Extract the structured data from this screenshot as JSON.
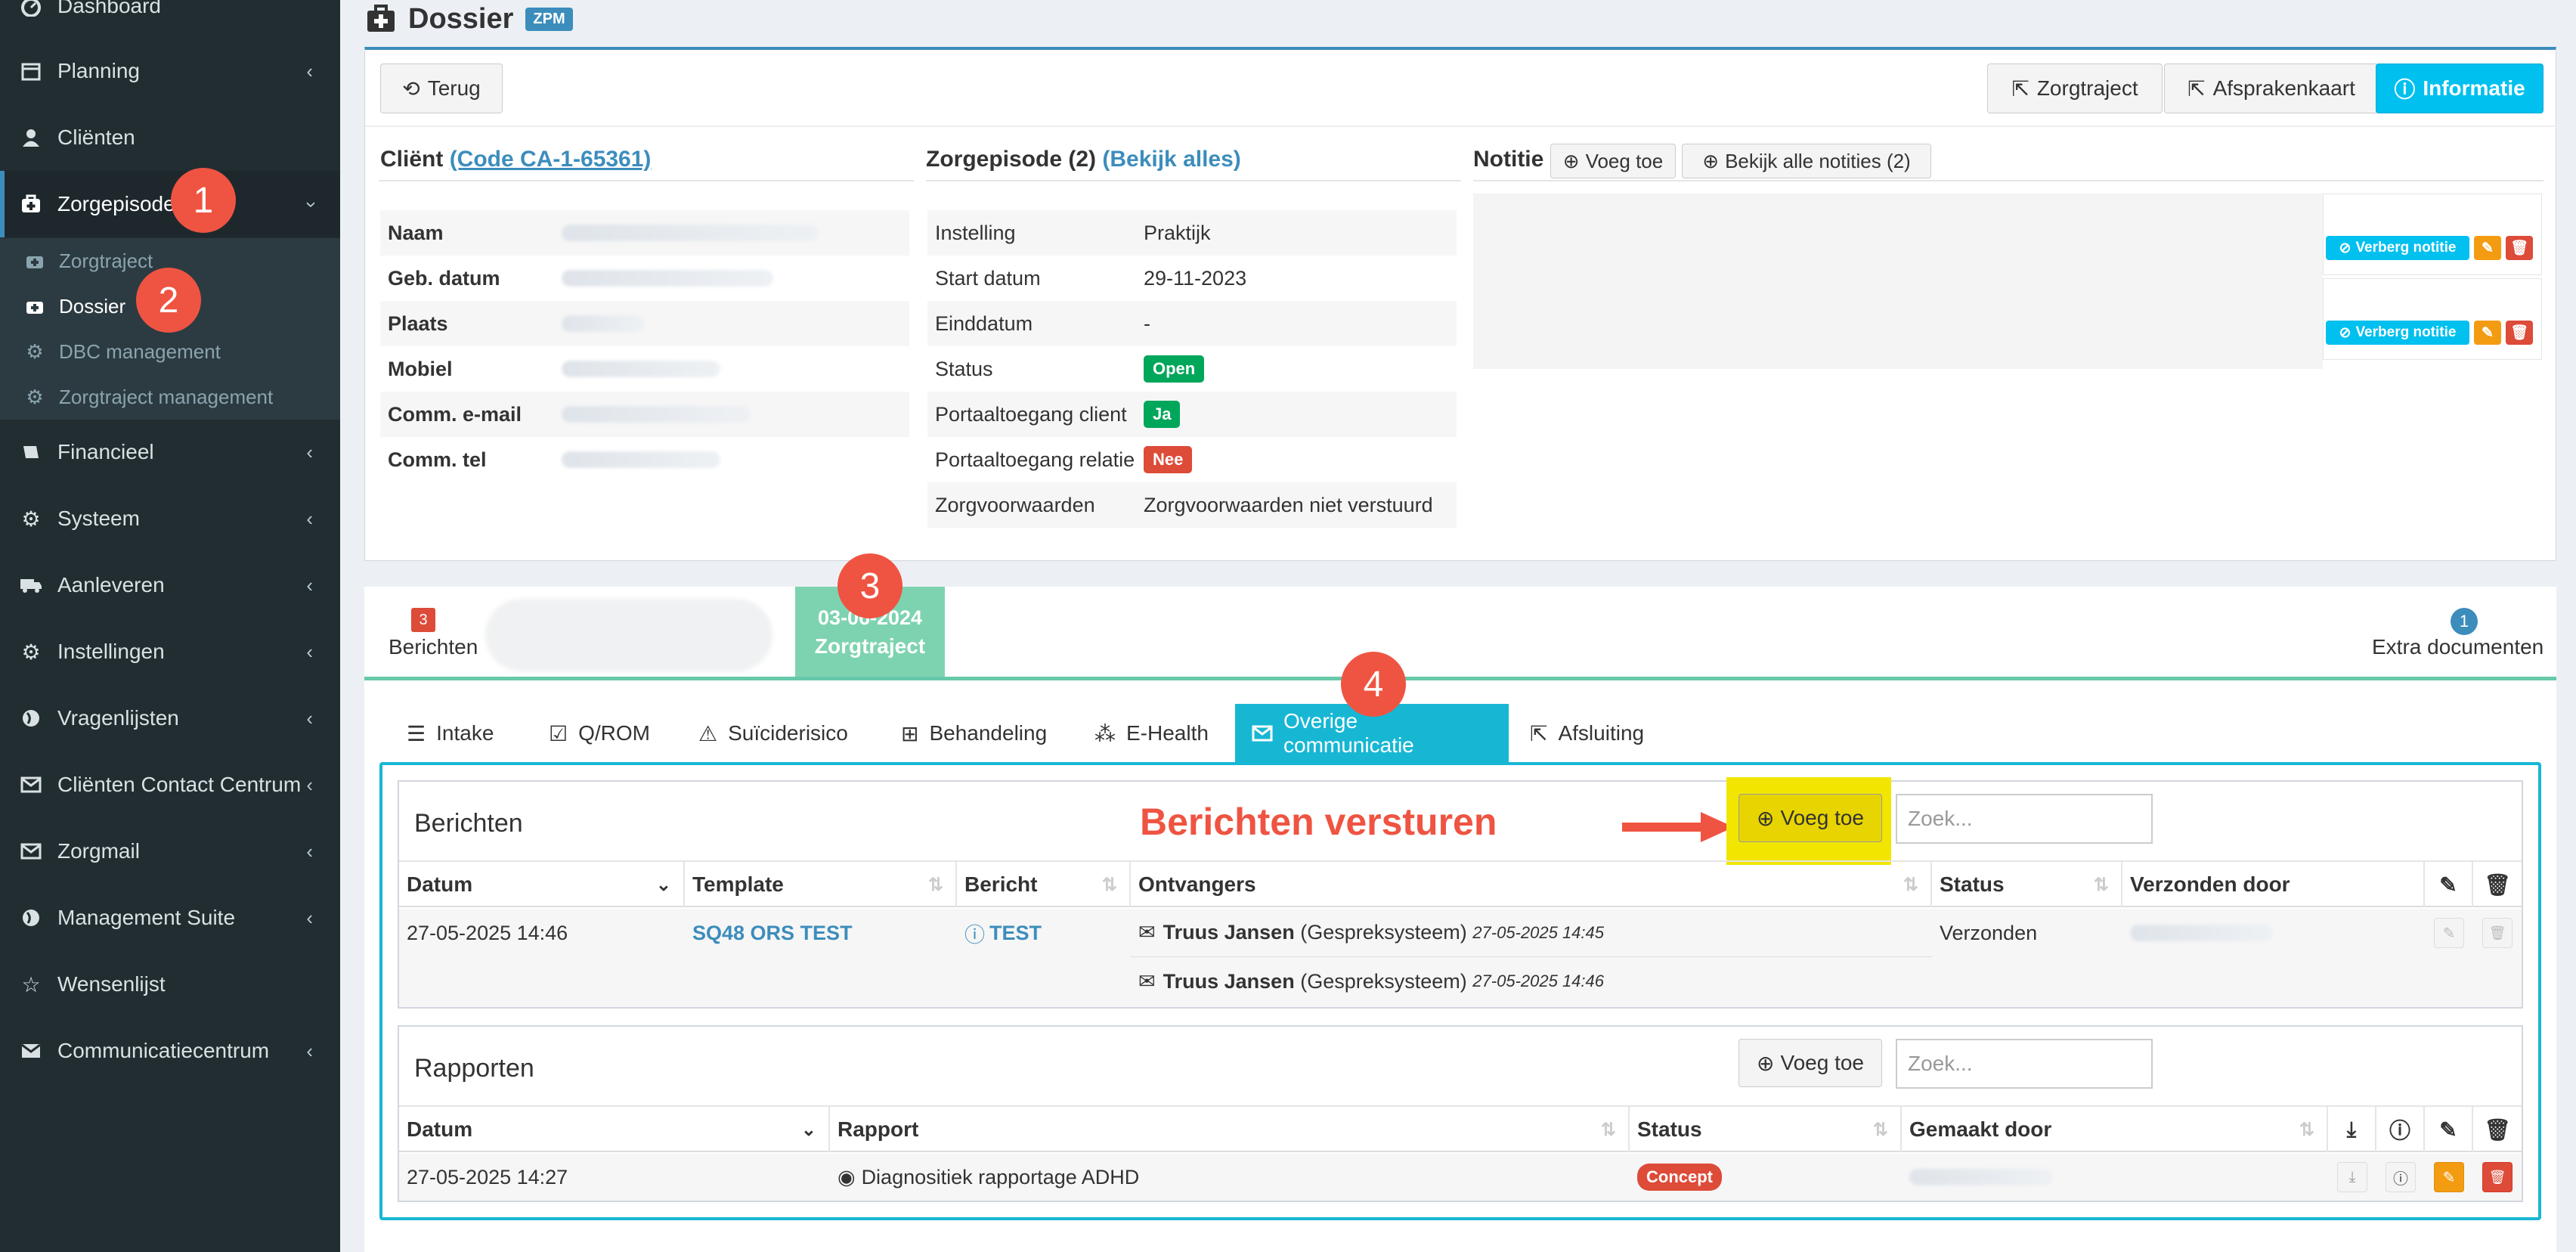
{
  "sidebar": {
    "items": [
      {
        "label": "Dashboard",
        "icon": "dashboard-icon"
      },
      {
        "label": "Planning",
        "icon": "calendar-icon"
      },
      {
        "label": "Cliënten",
        "icon": "user-icon"
      },
      {
        "label": "Zorgepisode",
        "icon": "medkit-icon"
      },
      {
        "label": "Financieel",
        "icon": "book-icon"
      },
      {
        "label": "Systeem",
        "icon": "cogs-icon"
      },
      {
        "label": "Aanleveren",
        "icon": "truck-icon"
      },
      {
        "label": "Instellingen",
        "icon": "gear-icon"
      },
      {
        "label": "Vragenlijsten",
        "icon": "globe-icon"
      },
      {
        "label": "Cliënten Contact Centrum",
        "icon": "envelope-icon"
      },
      {
        "label": "Zorgmail",
        "icon": "envelope-icon"
      },
      {
        "label": "Management Suite",
        "icon": "globe-icon"
      },
      {
        "label": "Wensenlijst",
        "icon": "star-icon"
      },
      {
        "label": "Communicatiecentrum",
        "icon": "envelope-icon"
      }
    ],
    "subitems": [
      {
        "label": "Zorgtraject"
      },
      {
        "label": "Dossier"
      },
      {
        "label": "DBC management"
      },
      {
        "label": "Zorgtraject management"
      }
    ]
  },
  "annotations": {
    "n1": "1",
    "n2": "2",
    "n3": "3",
    "n4": "4",
    "callout": "Berichten versturen"
  },
  "header": {
    "title": "Dossier",
    "badge": "ZPM"
  },
  "toolbar": {
    "back": "Terug",
    "zorgtraject": "Zorgtraject",
    "afsprakenkaart": "Afsprakenkaart",
    "informatie": "Informatie"
  },
  "client": {
    "title": "Cliënt",
    "code": "(Code CA-1-65361)",
    "fields": [
      "Naam",
      "Geb. datum",
      "Plaats",
      "Mobiel",
      "Comm. e-mail",
      "Comm. tel"
    ]
  },
  "episode": {
    "title": "Zorgepisode (2)",
    "link": "(Bekijk alles)",
    "rows": [
      {
        "k": "Instelling",
        "v": "Praktijk"
      },
      {
        "k": "Start datum",
        "v": "29-11-2023"
      },
      {
        "k": "Einddatum",
        "v": "-"
      },
      {
        "k": "Status",
        "v": "Open"
      },
      {
        "k": "Portaaltoegang client",
        "v": "Ja"
      },
      {
        "k": "Portaaltoegang relatie",
        "v": "Nee"
      },
      {
        "k": "Zorgvoorwaarden",
        "v": "Zorgvoorwaarden niet verstuurd"
      }
    ]
  },
  "notes": {
    "title": "Notitie",
    "add": "Voeg toe",
    "all": "Bekijk alle notities (2)",
    "hide": "Verberg notitie"
  },
  "timeline": {
    "berichten_count": "3",
    "berichten_label": "Berichten",
    "date": "03-06-2024",
    "date_label": "Zorgtraject",
    "extra_count": "1",
    "extra_label": "Extra documenten"
  },
  "tabs": [
    "Intake",
    "Q/ROM",
    "Suïciderisico",
    "Behandeling",
    "E-Health",
    "Overige communicatie",
    "Afsluiting"
  ],
  "berichten": {
    "title": "Berichten",
    "add": "Voeg toe",
    "search_placeholder": "Zoek...",
    "headers": [
      "Datum",
      "Template",
      "Bericht",
      "Ontvangers",
      "Status",
      "Verzonden door"
    ],
    "row": {
      "datum": "27-05-2025 14:46",
      "template": "SQ48 ORS TEST",
      "bericht": "TEST",
      "status": "Verzonden",
      "recipients": [
        {
          "name": "Truus Jansen",
          "system": "(Gespreksysteem)",
          "time": "27-05-2025 14:45"
        },
        {
          "name": "Truus Jansen",
          "system": "(Gespreksysteem)",
          "time": "27-05-2025 14:46"
        }
      ]
    }
  },
  "rapporten": {
    "title": "Rapporten",
    "add": "Voeg toe",
    "search_placeholder": "Zoek...",
    "headers": [
      "Datum",
      "Rapport",
      "Status",
      "Gemaakt door"
    ],
    "row": {
      "datum": "27-05-2025 14:27",
      "rapport": "Diagnositiek rapportage ADHD",
      "status": "Concept"
    }
  },
  "colors": {
    "sidebar": "#222d32",
    "accent": "#3c8dbc",
    "info": "#00c0ef",
    "teal": "#17b7d4",
    "callout": "#ef5442",
    "highlight": "#f2e600"
  }
}
